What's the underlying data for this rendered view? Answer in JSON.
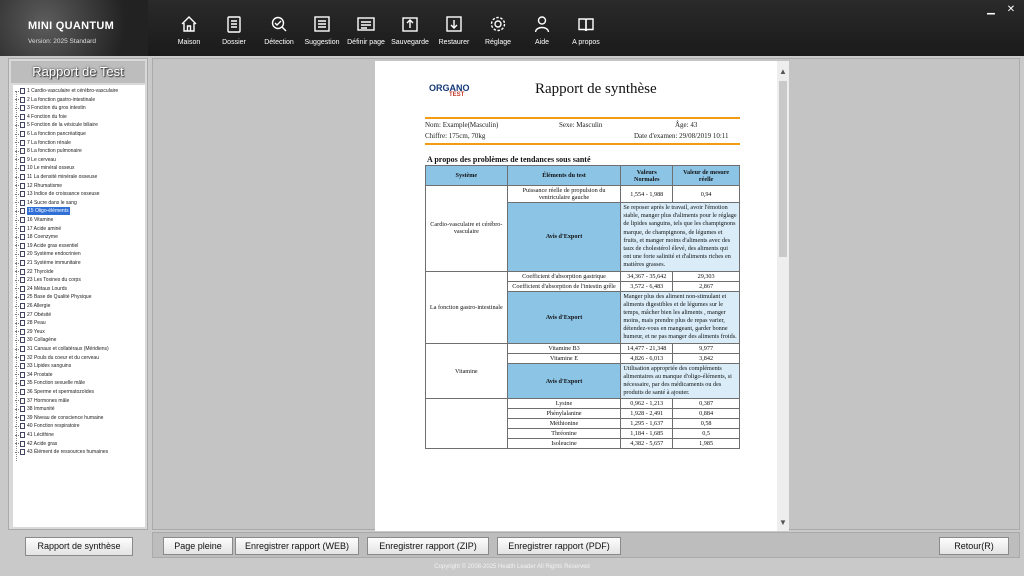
{
  "brand": {
    "name": "MINI QUANTUM",
    "version": "Version: 2025 Standard"
  },
  "toolbar": [
    {
      "label": "Maison",
      "icon": "home-icon"
    },
    {
      "label": "Dossier",
      "icon": "folder-icon"
    },
    {
      "label": "Détection",
      "icon": "detection-icon"
    },
    {
      "label": "Suggestion",
      "icon": "suggestion-icon"
    },
    {
      "label": "Définir page",
      "icon": "page-setup-icon"
    },
    {
      "label": "Sauvegarde",
      "icon": "backup-icon"
    },
    {
      "label": "Restaurer",
      "icon": "restore-icon"
    },
    {
      "label": "Réglage",
      "icon": "gear-icon"
    },
    {
      "label": "Aide",
      "icon": "help-icon"
    },
    {
      "label": "A propos",
      "icon": "about-icon"
    }
  ],
  "window_controls": {
    "minimize": "▁",
    "close": "✕"
  },
  "left_panel": {
    "title": "Rapport de Test",
    "items": [
      "1 Cardio-vasculaire et cérébro-vasculaire",
      "2 La fonction gastro-intestinale",
      "3 Fonction du gros intestin",
      "4 Fonction du foie",
      "5 Fonction de la vésicule biliaire",
      "6 La fonction pancréatique",
      "7 La fonction rénale",
      "8 La fonction pulmonaire",
      "9 Le cerveau",
      "10 Le minéral osseux",
      "11 La densité minérale osseuse",
      "12 Rhumatisme",
      "13 Indice de croissance osseuse",
      "14 Sucre dans le sang",
      "15 Oligo-éléments",
      "16 Vitamine",
      "17 Acide aminé",
      "18 Coenzyme",
      "19 Acide gras essentiel",
      "20 Système endocrinien",
      "21 Système immunitaire",
      "22 Thyroïde",
      "23 Les Toxines du corps",
      "24 Métaux Lourds",
      "25 Base de Qualité Physique",
      "26 Allergie",
      "27 Obésité",
      "28 Peau",
      "29 Yeux",
      "30 Collagène",
      "31 Canaux et collatéraux (Méridiens)",
      "32 Pouls du coeur et du cerveau",
      "33 Lipides sanguins",
      "34 Prostate",
      "35 Fonction sexuelle mâle",
      "36 Sperme et spermatozoïdes",
      "37 Hormones mâle",
      "38 Immunité",
      "39 Niveau de conscience humaine",
      "40 Fonction respiratoire",
      "41 Lécithine",
      "42 Acide gras",
      "43 Élément de ressources humaines"
    ],
    "selected_index": 14
  },
  "report": {
    "logo_main": "ORGANO",
    "logo_sub": "TEST",
    "title": "Rapport de synthèse",
    "nom": "Nom: Example(Masculin)",
    "sexe": "Sexe: Masculin",
    "age": "Âge: 43",
    "chiffre": "Chiffre: 175cm, 70kg",
    "date": "Date d'examen: 29/08/2019 10:11",
    "section_title": "A propos des problèmes de tendances sous santé",
    "headers": [
      "Système",
      "Éléments du test",
      "Valeurs Normales",
      "Valeur de mesure réelle"
    ],
    "groups": [
      {
        "system": "Cardio-vasculaire et cérébro-vasculaire",
        "rows": [
          {
            "element": "Puissance réelle de propulsion du ventriculaire gauche",
            "normal": "1,554 - 1,988",
            "value": "0,94"
          }
        ],
        "avis": "Avis d'Export",
        "advice": "Se reposer après le travail, avoir l'émotion stable, manger plus d'aliments pour le réglage de lipides sanguins, tels que les champignons marque, de champignons, de légumes et fruits, et manger moins d'aliments avec des taux de cholestérol élevé, des aliments qui ont une forte salinité et d'aliments riches en matières grasses."
      },
      {
        "system": "La fonction gastro-intestinale",
        "rows": [
          {
            "element": "Coefficient d'absorption gastrique",
            "normal": "34,367 - 35,642",
            "value": "29,303"
          },
          {
            "element": "Coefficient d'absorption de l'intestin grêle",
            "normal": "3,572 - 6,483",
            "value": "2,867"
          }
        ],
        "avis": "Avis d'Export",
        "advice": "Manger plus des aliment non-stimulant et aliments digestibles et de légumes sur le temps, mâcher bien les aliments , manger moins, mais prendre plus de repas varier, détendez-vous en mangeant, garder bonne humeur, et ne pas manger des aliments froids."
      },
      {
        "system": "Vitamine",
        "rows": [
          {
            "element": "Vitamine B3",
            "normal": "14,477 - 21,348",
            "value": "9,977"
          },
          {
            "element": "Vitamine E",
            "normal": "4,826 - 6,013",
            "value": "3,842"
          }
        ],
        "avis": "Avis d'Export",
        "advice": "Utilisation appropriée des compléments alimentaires au manque d'oligo-éléments, si nécessaire, par des médicaments ou des produits de santé à ajouter."
      },
      {
        "system": "",
        "rows": [
          {
            "element": "Lysine",
            "normal": "0,962 - 1,213",
            "value": "0,387"
          },
          {
            "element": "Phénylalanine",
            "normal": "1,928 - 2,491",
            "value": "0,884"
          },
          {
            "element": "Méthionine",
            "normal": "1,295 - 1,637",
            "value": "0,58"
          },
          {
            "element": "Thréonine",
            "normal": "1,184 - 1,685",
            "value": "0,5"
          },
          {
            "element": "Isoleucine",
            "normal": "4,382 - 5,657",
            "value": "1,985"
          }
        ]
      }
    ]
  },
  "left_button": "Rapport de synthèse",
  "buttons": {
    "full_page": "Page pleine",
    "save_web": "Enregistrer rapport (WEB)",
    "save_zip": "Enregistrer rapport (ZIP)",
    "save_pdf": "Enregistrer rapport (PDF)",
    "back": "Retour(R)"
  },
  "copyright": "Copyright © 2008-2025 Health Leader All Rights Reserved"
}
